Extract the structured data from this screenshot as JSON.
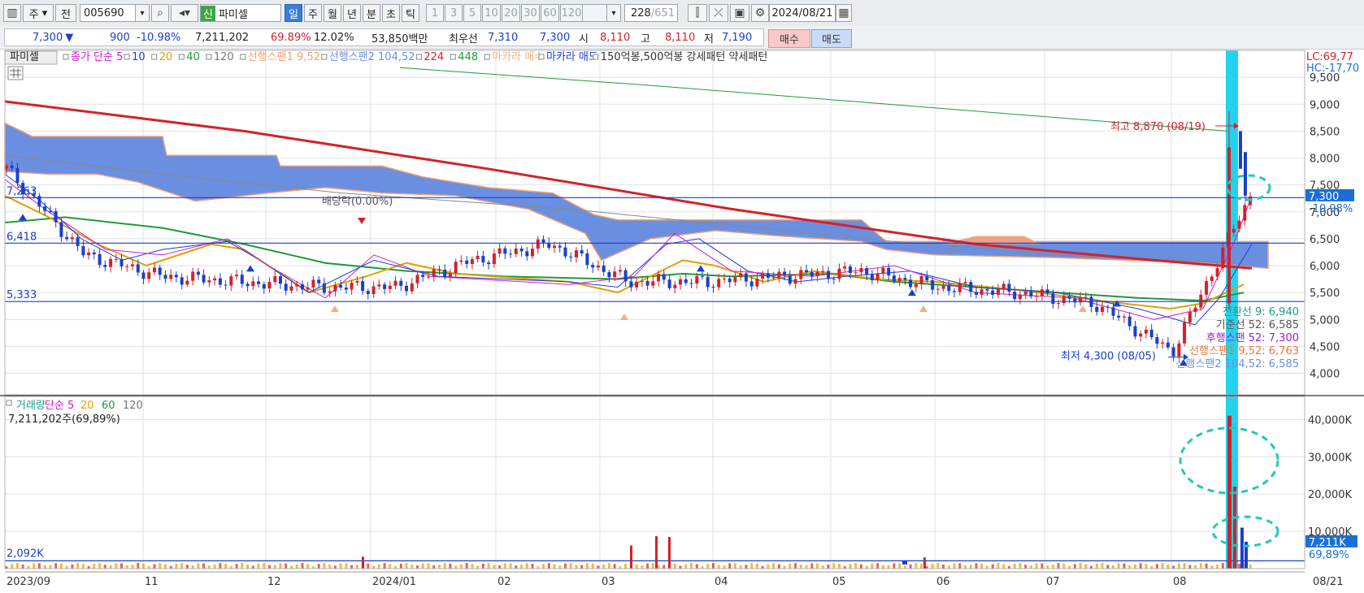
{
  "toolbar": {
    "type_select": "주",
    "prev_label": "전",
    "code": "005690",
    "indicator": "파미셀",
    "indicator_prefix": "신",
    "periods": [
      "일",
      "주",
      "월",
      "년",
      "분",
      "초",
      "틱"
    ],
    "active_period": "일",
    "minute_values": [
      "1",
      "3",
      "5",
      "10",
      "20",
      "30",
      "60",
      "120"
    ],
    "count": "228",
    "total": "/651",
    "date": "2024/08/21"
  },
  "quote": {
    "price": "7,300",
    "change_arrow": "▼",
    "change": "900",
    "change_pct": "-10.98%",
    "volume": "7,211,202",
    "volume_ratio": "69.89%",
    "turnover": "12.02%",
    "amount": "53,850백만",
    "best_ask_label": "최우선",
    "best_ask": "7,310",
    "best_bid": "7,300",
    "open_label": "시",
    "open": "8,110",
    "high_label": "고",
    "high": "8,110",
    "low_label": "저",
    "low": "7,190",
    "buy_label": "매수",
    "sell_label": "매도"
  },
  "legend_top": {
    "name": "파미셀",
    "items": [
      {
        "text": "종가 단순 5",
        "color": "#d11ad1"
      },
      {
        "text": "10",
        "color": "#1a3fcf"
      },
      {
        "text": "20",
        "color": "#e0a000"
      },
      {
        "text": "40",
        "color": "#1f9a3a"
      },
      {
        "text": "120",
        "color": "#777777"
      },
      {
        "text": "선행스팬1 9,52",
        "color": "#f2a070"
      },
      {
        "text": "선행스팬2 104,52",
        "color": "#6a8fe0"
      },
      {
        "text": "224",
        "color": "#d3222a"
      },
      {
        "text": "448",
        "color": "#1f9a3a"
      },
      {
        "text": "마카라 매수",
        "color": "#f5b080"
      },
      {
        "text": "마카라 매도",
        "color": "#1a3fcf"
      },
      {
        "text": "150억봉,500억봉 강세패턴  약세패턴",
        "color": "#333333"
      }
    ]
  },
  "right_top": {
    "lc": "LC:69,77",
    "hc": "HC:-17,70"
  },
  "annotations": {
    "high": "최고 8,870 (08/19)",
    "low": "최저 4,300 (08/05)",
    "dividend": "배당락(0.00%)",
    "lines": [
      "7,263",
      "6,418",
      "5,333"
    ],
    "price_tag": "7,300",
    "price_tag_pct": "-10.98%",
    "ichimoku": [
      {
        "text": "전환선 9: 6,940",
        "color": "#1f9a8a"
      },
      {
        "text": "기준선 52: 6,585",
        "color": "#555555"
      },
      {
        "text": "후행스팬 52: 7,300",
        "color": "#a01ad1"
      },
      {
        "text": "선행스팬1 9,52: 6,763",
        "color": "#e07a40"
      },
      {
        "text": "선행스팬2 104,52: 6,585",
        "color": "#6a8fe0"
      }
    ]
  },
  "legend_vol": {
    "items": [
      {
        "text": "거래량",
        "color": "#1f9a8a"
      },
      {
        "text": "단순 5",
        "color": "#d11ad1"
      },
      {
        "text": "20",
        "color": "#e0a000"
      },
      {
        "text": "60",
        "color": "#1f9a3a"
      },
      {
        "text": "120",
        "color": "#777777"
      }
    ],
    "value": "7,211,202주(69,89%)",
    "hline": "2,092K",
    "tag": "7,211K",
    "tag_pct": "69,89%"
  },
  "x_labels": [
    "2023/09",
    "11",
    "12",
    "2024/01",
    "02",
    "03",
    "04",
    "05",
    "06",
    "07",
    "08"
  ],
  "x_last": "08/21",
  "chart_data": [
    {
      "type": "line",
      "title": "파미셀",
      "y_ticks": [
        4000,
        4500,
        5000,
        5500,
        6000,
        6500,
        7000,
        7500,
        8000,
        8500,
        9000,
        9500
      ],
      "ylim": [
        3600,
        10000
      ],
      "x": [
        "2023/09",
        "11",
        "12",
        "2024/01",
        "02",
        "03",
        "04",
        "05",
        "06",
        "07",
        "08",
        "08/21"
      ],
      "series": [
        {
          "name": "224",
          "values": [
            9050,
            8400,
            7850,
            7300,
            6850,
            6350,
            6000,
            5850
          ]
        },
        {
          "name": "448",
          "values": [
            9800,
            9400,
            8700,
            8100,
            7500
          ]
        }
      ],
      "close_approx": [
        7800,
        6200,
        5800,
        5700,
        5600,
        5600,
        6100,
        6400,
        5700,
        5700,
        5800,
        5900,
        5600,
        5500,
        5300,
        4400,
        7300
      ],
      "highlights": {
        "high": 8870,
        "low": 4300,
        "last": 7300
      },
      "horizontal_lines": [
        7263,
        6418,
        5333
      ]
    },
    {
      "type": "bar",
      "title": "거래량",
      "y_ticks_labels": [
        "10,000K",
        "20,000K",
        "30,000K",
        "40,000K"
      ],
      "ylim": [
        0,
        44000
      ],
      "last_volume_k": 7211,
      "peak_volume_k": 41000
    }
  ],
  "colors": {
    "up": "#d3222a",
    "down": "#1a3fcf",
    "cloud": "#6a8fe0",
    "cloud_up": "#f0a080",
    "highlight": "#22d3ee"
  }
}
